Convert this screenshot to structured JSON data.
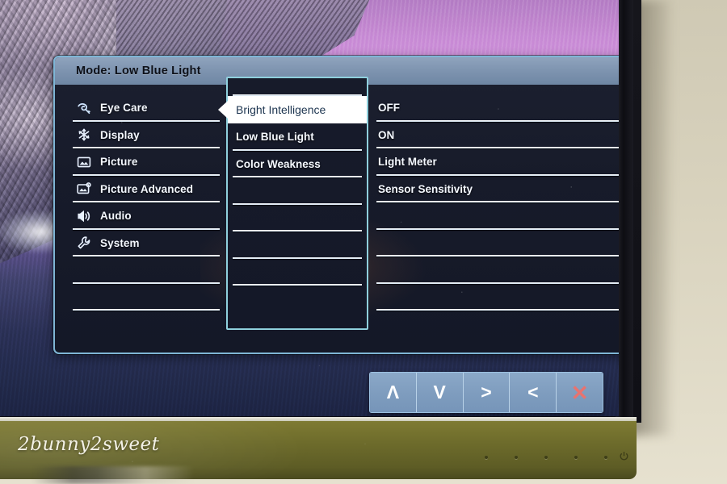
{
  "osd": {
    "title_prefix": "Mode:",
    "title_mode": "Low Blue Light",
    "title_full": "Mode: Low Blue Light",
    "nav": {
      "items": [
        {
          "label": "Eye Care",
          "icon": "eye-care-icon",
          "selected": true
        },
        {
          "label": "Display",
          "icon": "display-icon",
          "selected": false
        },
        {
          "label": "Picture",
          "icon": "picture-icon",
          "selected": false
        },
        {
          "label": "Picture Advanced",
          "icon": "picture-advanced-icon",
          "selected": false
        },
        {
          "label": "Audio",
          "icon": "audio-icon",
          "selected": false
        },
        {
          "label": "System",
          "icon": "system-icon",
          "selected": false
        },
        {
          "label": "",
          "icon": "",
          "selected": false
        },
        {
          "label": "",
          "icon": "",
          "selected": false
        }
      ]
    },
    "submenu": {
      "items": [
        {
          "label": "Bright Intelligence",
          "selected": true
        },
        {
          "label": "Low Blue Light",
          "selected": false
        },
        {
          "label": "Color Weakness",
          "selected": false
        },
        {
          "label": "",
          "selected": false
        },
        {
          "label": "",
          "selected": false
        },
        {
          "label": "",
          "selected": false
        },
        {
          "label": "",
          "selected": false
        },
        {
          "label": "",
          "selected": false
        }
      ]
    },
    "values": {
      "items": [
        {
          "label": "OFF",
          "checked": true,
          "check_glyph": "✔"
        },
        {
          "label": "ON",
          "checked": false,
          "check_glyph": ""
        },
        {
          "label": "Light Meter",
          "checked": false,
          "check_glyph": ""
        },
        {
          "label": "Sensor Sensitivity",
          "checked": false,
          "check_glyph": ""
        },
        {
          "label": "",
          "checked": false,
          "check_glyph": ""
        },
        {
          "label": "",
          "checked": false,
          "check_glyph": ""
        },
        {
          "label": "",
          "checked": false,
          "check_glyph": ""
        },
        {
          "label": "",
          "checked": false,
          "check_glyph": ""
        }
      ]
    },
    "colors": {
      "border": "#7fb6d6",
      "titlebar": "#7c92ae",
      "panel_bg": "#171b2a",
      "highlight_bg": "#ffffff",
      "highlight_text": "#1d3550",
      "check": "#49b9f2",
      "exit_key": "#e8736f"
    }
  },
  "keybar": {
    "keys": [
      {
        "name": "up",
        "glyph": "Λ"
      },
      {
        "name": "down",
        "glyph": "V"
      },
      {
        "name": "right",
        "glyph": ">"
      },
      {
        "name": "left",
        "glyph": "<"
      },
      {
        "name": "exit",
        "glyph": "✕"
      }
    ]
  },
  "monitor": {
    "watermark": "2bunny2sweet"
  }
}
